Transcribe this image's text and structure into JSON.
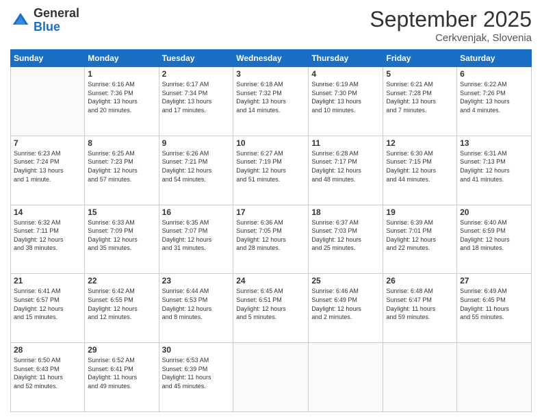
{
  "header": {
    "logo_general": "General",
    "logo_blue": "Blue",
    "month_title": "September 2025",
    "location": "Cerkvenjak, Slovenia"
  },
  "days_of_week": [
    "Sunday",
    "Monday",
    "Tuesday",
    "Wednesday",
    "Thursday",
    "Friday",
    "Saturday"
  ],
  "weeks": [
    [
      {
        "day": "",
        "info": ""
      },
      {
        "day": "1",
        "info": "Sunrise: 6:16 AM\nSunset: 7:36 PM\nDaylight: 13 hours\nand 20 minutes."
      },
      {
        "day": "2",
        "info": "Sunrise: 6:17 AM\nSunset: 7:34 PM\nDaylight: 13 hours\nand 17 minutes."
      },
      {
        "day": "3",
        "info": "Sunrise: 6:18 AM\nSunset: 7:32 PM\nDaylight: 13 hours\nand 14 minutes."
      },
      {
        "day": "4",
        "info": "Sunrise: 6:19 AM\nSunset: 7:30 PM\nDaylight: 13 hours\nand 10 minutes."
      },
      {
        "day": "5",
        "info": "Sunrise: 6:21 AM\nSunset: 7:28 PM\nDaylight: 13 hours\nand 7 minutes."
      },
      {
        "day": "6",
        "info": "Sunrise: 6:22 AM\nSunset: 7:26 PM\nDaylight: 13 hours\nand 4 minutes."
      }
    ],
    [
      {
        "day": "7",
        "info": "Sunrise: 6:23 AM\nSunset: 7:24 PM\nDaylight: 13 hours\nand 1 minute."
      },
      {
        "day": "8",
        "info": "Sunrise: 6:25 AM\nSunset: 7:23 PM\nDaylight: 12 hours\nand 57 minutes."
      },
      {
        "day": "9",
        "info": "Sunrise: 6:26 AM\nSunset: 7:21 PM\nDaylight: 12 hours\nand 54 minutes."
      },
      {
        "day": "10",
        "info": "Sunrise: 6:27 AM\nSunset: 7:19 PM\nDaylight: 12 hours\nand 51 minutes."
      },
      {
        "day": "11",
        "info": "Sunrise: 6:28 AM\nSunset: 7:17 PM\nDaylight: 12 hours\nand 48 minutes."
      },
      {
        "day": "12",
        "info": "Sunrise: 6:30 AM\nSunset: 7:15 PM\nDaylight: 12 hours\nand 44 minutes."
      },
      {
        "day": "13",
        "info": "Sunrise: 6:31 AM\nSunset: 7:13 PM\nDaylight: 12 hours\nand 41 minutes."
      }
    ],
    [
      {
        "day": "14",
        "info": "Sunrise: 6:32 AM\nSunset: 7:11 PM\nDaylight: 12 hours\nand 38 minutes."
      },
      {
        "day": "15",
        "info": "Sunrise: 6:33 AM\nSunset: 7:09 PM\nDaylight: 12 hours\nand 35 minutes."
      },
      {
        "day": "16",
        "info": "Sunrise: 6:35 AM\nSunset: 7:07 PM\nDaylight: 12 hours\nand 31 minutes."
      },
      {
        "day": "17",
        "info": "Sunrise: 6:36 AM\nSunset: 7:05 PM\nDaylight: 12 hours\nand 28 minutes."
      },
      {
        "day": "18",
        "info": "Sunrise: 6:37 AM\nSunset: 7:03 PM\nDaylight: 12 hours\nand 25 minutes."
      },
      {
        "day": "19",
        "info": "Sunrise: 6:39 AM\nSunset: 7:01 PM\nDaylight: 12 hours\nand 22 minutes."
      },
      {
        "day": "20",
        "info": "Sunrise: 6:40 AM\nSunset: 6:59 PM\nDaylight: 12 hours\nand 18 minutes."
      }
    ],
    [
      {
        "day": "21",
        "info": "Sunrise: 6:41 AM\nSunset: 6:57 PM\nDaylight: 12 hours\nand 15 minutes."
      },
      {
        "day": "22",
        "info": "Sunrise: 6:42 AM\nSunset: 6:55 PM\nDaylight: 12 hours\nand 12 minutes."
      },
      {
        "day": "23",
        "info": "Sunrise: 6:44 AM\nSunset: 6:53 PM\nDaylight: 12 hours\nand 8 minutes."
      },
      {
        "day": "24",
        "info": "Sunrise: 6:45 AM\nSunset: 6:51 PM\nDaylight: 12 hours\nand 5 minutes."
      },
      {
        "day": "25",
        "info": "Sunrise: 6:46 AM\nSunset: 6:49 PM\nDaylight: 12 hours\nand 2 minutes."
      },
      {
        "day": "26",
        "info": "Sunrise: 6:48 AM\nSunset: 6:47 PM\nDaylight: 11 hours\nand 59 minutes."
      },
      {
        "day": "27",
        "info": "Sunrise: 6:49 AM\nSunset: 6:45 PM\nDaylight: 11 hours\nand 55 minutes."
      }
    ],
    [
      {
        "day": "28",
        "info": "Sunrise: 6:50 AM\nSunset: 6:43 PM\nDaylight: 11 hours\nand 52 minutes."
      },
      {
        "day": "29",
        "info": "Sunrise: 6:52 AM\nSunset: 6:41 PM\nDaylight: 11 hours\nand 49 minutes."
      },
      {
        "day": "30",
        "info": "Sunrise: 6:53 AM\nSunset: 6:39 PM\nDaylight: 11 hours\nand 45 minutes."
      },
      {
        "day": "",
        "info": ""
      },
      {
        "day": "",
        "info": ""
      },
      {
        "day": "",
        "info": ""
      },
      {
        "day": "",
        "info": ""
      }
    ]
  ]
}
